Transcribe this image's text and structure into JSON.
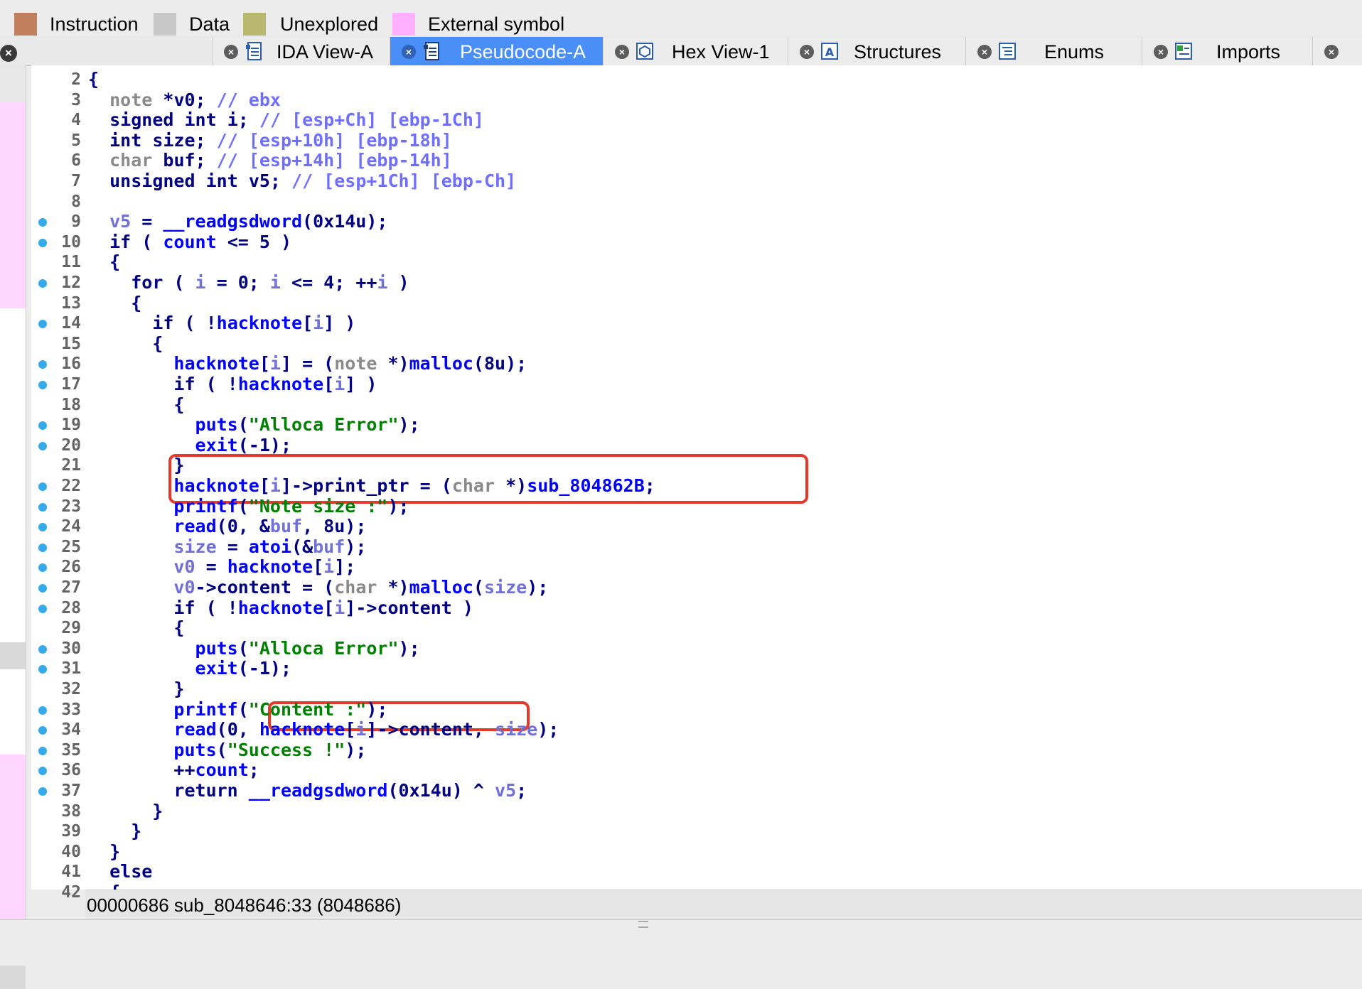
{
  "legend": [
    {
      "label": "Instruction",
      "color": "#c08060"
    },
    {
      "label": "Data",
      "color": "#c8c8c8"
    },
    {
      "label": "Unexplored",
      "color": "#b8b870"
    },
    {
      "label": "External symbol",
      "color": "#ffb0ff"
    }
  ],
  "tabs": [
    {
      "label": "IDA View-A",
      "icon": "disassembly-view-icon",
      "active": false
    },
    {
      "label": "Pseudocode-A",
      "icon": "pseudocode-icon",
      "active": true
    },
    {
      "label": "Hex View-1",
      "icon": "hex-view-icon",
      "active": false
    },
    {
      "label": "Structures",
      "icon": "structures-icon",
      "active": false
    },
    {
      "label": "Enums",
      "icon": "enums-icon",
      "active": false
    },
    {
      "label": "Imports",
      "icon": "imports-icon",
      "active": false
    }
  ],
  "code": [
    {
      "n": "2",
      "dot": false,
      "t": "{"
    },
    {
      "n": "3",
      "dot": false,
      "t": "  note *v0; // ebx"
    },
    {
      "n": "4",
      "dot": false,
      "t": "  signed int i; // [esp+Ch] [ebp-1Ch]"
    },
    {
      "n": "5",
      "dot": false,
      "t": "  int size; // [esp+10h] [ebp-18h]"
    },
    {
      "n": "6",
      "dot": false,
      "t": "  char buf; // [esp+14h] [ebp-14h]"
    },
    {
      "n": "7",
      "dot": false,
      "t": "  unsigned int v5; // [esp+1Ch] [ebp-Ch]"
    },
    {
      "n": "8",
      "dot": false,
      "t": ""
    },
    {
      "n": "9",
      "dot": true,
      "t": "  v5 = __readgsdword(0x14u);"
    },
    {
      "n": "10",
      "dot": true,
      "t": "  if ( count <= 5 )"
    },
    {
      "n": "11",
      "dot": false,
      "t": "  {"
    },
    {
      "n": "12",
      "dot": true,
      "t": "    for ( i = 0; i <= 4; ++i )"
    },
    {
      "n": "13",
      "dot": false,
      "t": "    {"
    },
    {
      "n": "14",
      "dot": true,
      "t": "      if ( !hacknote[i] )"
    },
    {
      "n": "15",
      "dot": false,
      "t": "      {"
    },
    {
      "n": "16",
      "dot": true,
      "t": "        hacknote[i] = (note *)malloc(8u);"
    },
    {
      "n": "17",
      "dot": true,
      "t": "        if ( !hacknote[i] )"
    },
    {
      "n": "18",
      "dot": false,
      "t": "        {"
    },
    {
      "n": "19",
      "dot": true,
      "t": "          puts(\"Alloca Error\");"
    },
    {
      "n": "20",
      "dot": true,
      "t": "          exit(-1);"
    },
    {
      "n": "21",
      "dot": false,
      "t": "        }"
    },
    {
      "n": "22",
      "dot": true,
      "t": "        hacknote[i]->print_ptr = (char *)sub_804862B;"
    },
    {
      "n": "23",
      "dot": true,
      "t": "        printf(\"Note size :\");"
    },
    {
      "n": "24",
      "dot": true,
      "t": "        read(0, &buf, 8u);"
    },
    {
      "n": "25",
      "dot": true,
      "t": "        size = atoi(&buf);"
    },
    {
      "n": "26",
      "dot": true,
      "t": "        v0 = hacknote[i];"
    },
    {
      "n": "27",
      "dot": true,
      "t": "        v0->content = (char *)malloc(size);"
    },
    {
      "n": "28",
      "dot": true,
      "t": "        if ( !hacknote[i]->content )"
    },
    {
      "n": "29",
      "dot": false,
      "t": "        {"
    },
    {
      "n": "30",
      "dot": true,
      "t": "          puts(\"Alloca Error\");"
    },
    {
      "n": "31",
      "dot": true,
      "t": "          exit(-1);"
    },
    {
      "n": "32",
      "dot": false,
      "t": "        }"
    },
    {
      "n": "33",
      "dot": true,
      "t": "        printf(\"Content :\");"
    },
    {
      "n": "34",
      "dot": true,
      "t": "        read(0, hacknote[i]->content, size);"
    },
    {
      "n": "35",
      "dot": true,
      "t": "        puts(\"Success !\");"
    },
    {
      "n": "36",
      "dot": true,
      "t": "        ++count;"
    },
    {
      "n": "37",
      "dot": true,
      "t": "        return __readgsdword(0x14u) ^ v5;"
    },
    {
      "n": "38",
      "dot": false,
      "t": "      }"
    },
    {
      "n": "39",
      "dot": false,
      "t": "    }"
    },
    {
      "n": "40",
      "dot": false,
      "t": "  }"
    },
    {
      "n": "41",
      "dot": false,
      "t": "  else"
    },
    {
      "n": "42",
      "dot": false,
      "t": "  {"
    }
  ],
  "status": {
    "text": "00000686  sub_8048646:33 (8048686)"
  },
  "colors": {
    "accent": "#4a8ef7",
    "highlight": "#e33a2c",
    "breakpoint_dot": "#35a9e9"
  }
}
